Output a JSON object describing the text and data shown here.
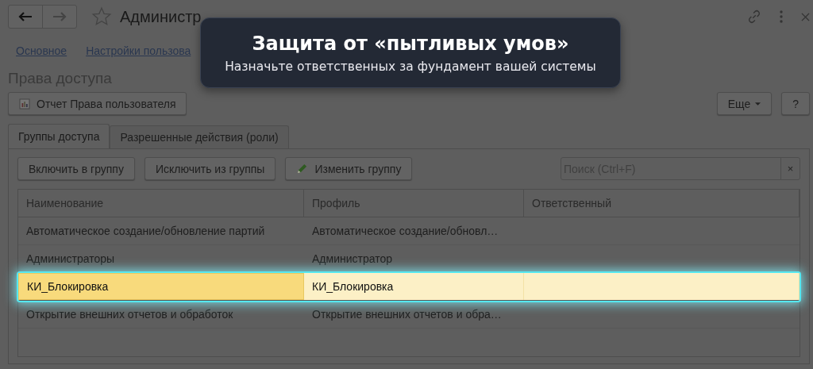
{
  "window": {
    "title": "Администр"
  },
  "links": [
    "Основное",
    "Настройки пользова"
  ],
  "heading": "Права доступа",
  "toolbar": {
    "report_button": "Отчет Права пользователя",
    "more_button": "Еще",
    "help_button": "?"
  },
  "tabs": [
    {
      "label": "Группы доступа",
      "selected": true
    },
    {
      "label": "Разрешенные действия (роли)",
      "selected": false
    }
  ],
  "group_toolbar": {
    "buttons": [
      {
        "label": "Включить в группу",
        "kind": "plain"
      },
      {
        "label": "Исключить из группы",
        "kind": "plain"
      },
      {
        "label": "Изменить группу",
        "kind": "edit"
      }
    ],
    "search": {
      "placeholder": "Поиск (Ctrl+F)",
      "clear": "×"
    }
  },
  "table": {
    "columns": [
      "Наименование",
      "Профиль",
      "Ответственный"
    ],
    "rows": [
      {
        "cells": [
          "Автоматическое создание/обновление партий",
          "Автоматическое создание/обновл…",
          ""
        ],
        "selected": false
      },
      {
        "cells": [
          "Администраторы",
          "Администратор",
          ""
        ],
        "selected": false
      },
      {
        "cells": [
          "КИ_Блокировка",
          "КИ_Блокировка",
          ""
        ],
        "selected": true
      },
      {
        "cells": [
          "Открытие внешних отчетов и обработок",
          "Открытие внешних отчетов и обра…",
          ""
        ],
        "selected": false
      }
    ]
  },
  "tooltip": {
    "title": "Защита от «пытливых умов»",
    "text": "Назначьте ответственных за фундамент вашей системы"
  }
}
